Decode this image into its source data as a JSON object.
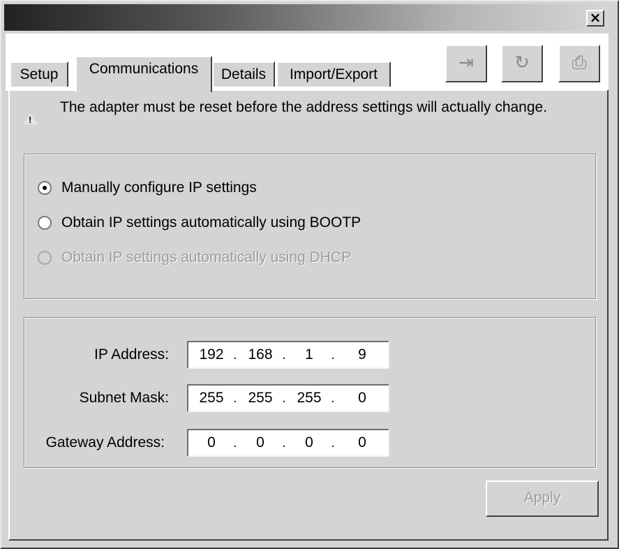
{
  "window": {
    "close_label": "×"
  },
  "tabs": [
    {
      "label": "Setup",
      "active": false
    },
    {
      "label": "Communications",
      "active": true
    },
    {
      "label": "Details",
      "active": false
    },
    {
      "label": "Import/Export",
      "active": false
    }
  ],
  "toolbar": {
    "buttons": [
      {
        "icon": "import-icon",
        "glyph": "⇥"
      },
      {
        "icon": "refresh-icon",
        "glyph": "↻"
      },
      {
        "icon": "print-icon",
        "glyph": "⎙"
      }
    ]
  },
  "warning": {
    "icon": "warning-icon",
    "text": "The adapter must be reset before the address settings will actually change."
  },
  "ip_mode": {
    "options": [
      {
        "label": "Manually configure IP settings",
        "selected": true,
        "enabled": true
      },
      {
        "label": "Obtain IP settings automatically using BOOTP",
        "selected": false,
        "enabled": true
      },
      {
        "label": "Obtain IP settings automatically using DHCP",
        "selected": false,
        "enabled": false
      }
    ]
  },
  "address": {
    "ip_label": "IP Address:",
    "ip": [
      "192",
      "168",
      "1",
      "9"
    ],
    "subnet_label": "Subnet Mask:",
    "subnet": [
      "255",
      "255",
      "255",
      "0"
    ],
    "gateway_label": "Gateway Address:",
    "gateway": [
      "0",
      "0",
      "0",
      "0"
    ]
  },
  "apply": {
    "label": "Apply",
    "enabled": false
  }
}
